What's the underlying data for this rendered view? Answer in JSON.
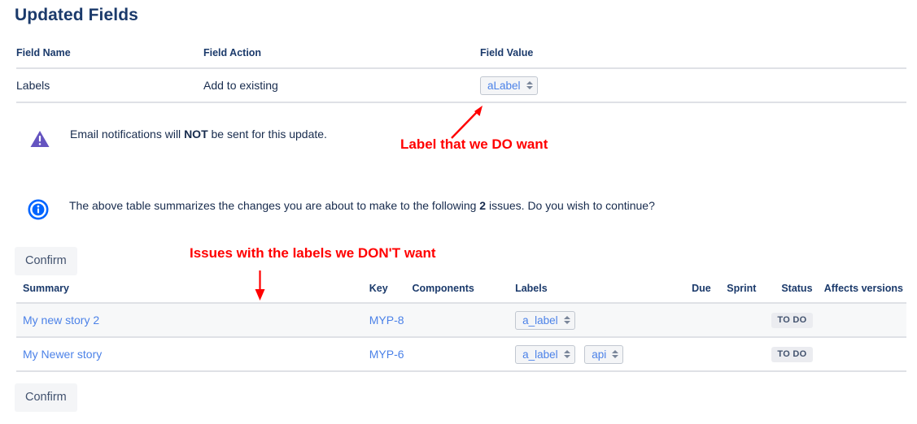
{
  "page": {
    "title": "Updated Fields"
  },
  "fields_table": {
    "headers": {
      "field_name": "Field Name",
      "field_action": "Field Action",
      "field_value": "Field Value"
    },
    "rows": [
      {
        "field_name": "Labels",
        "field_action": "Add to existing",
        "field_value": "aLabel"
      }
    ]
  },
  "notices": {
    "warning": {
      "icon": "warning-triangle-icon",
      "text_before": "Email notifications will ",
      "text_bold": "NOT",
      "text_after": " be sent for this update."
    },
    "info": {
      "icon": "info-circle-icon",
      "text_before": "The above table summarizes the changes you are about to make to the following ",
      "text_bold": "2",
      "text_after": " issues. Do you wish to continue?"
    }
  },
  "buttons": {
    "confirm_top": "Confirm",
    "confirm_bottom": "Confirm"
  },
  "issues_table": {
    "headers": {
      "summary": "Summary",
      "key": "Key",
      "components": "Components",
      "labels": "Labels",
      "due": "Due",
      "sprint": "Sprint",
      "status": "Status",
      "affects_versions": "Affects versions"
    },
    "rows": [
      {
        "summary": "My new story 2",
        "key": "MYP-8",
        "components": "",
        "labels": [
          "a_label"
        ],
        "due": "",
        "sprint": "",
        "status": "TO DO",
        "affects_versions": ""
      },
      {
        "summary": "My Newer story",
        "key": "MYP-6",
        "components": "",
        "labels": [
          "a_label",
          "api"
        ],
        "due": "",
        "sprint": "",
        "status": "TO DO",
        "affects_versions": ""
      }
    ]
  },
  "annotations": [
    {
      "text": "Label that we DO want",
      "color": "#FF0000"
    },
    {
      "text": "Issues with the labels we DON'T want",
      "color": "#FF0000"
    }
  ],
  "colors": {
    "link": "#4C82E8",
    "heading": "#1B3A6B",
    "text": "#172B4D",
    "annotation": "#FF0000",
    "warning_icon": "#6554C0",
    "info_icon": "#0065FF",
    "row_alt_bg": "#F7F8F9",
    "border": "#DFE1E6"
  }
}
